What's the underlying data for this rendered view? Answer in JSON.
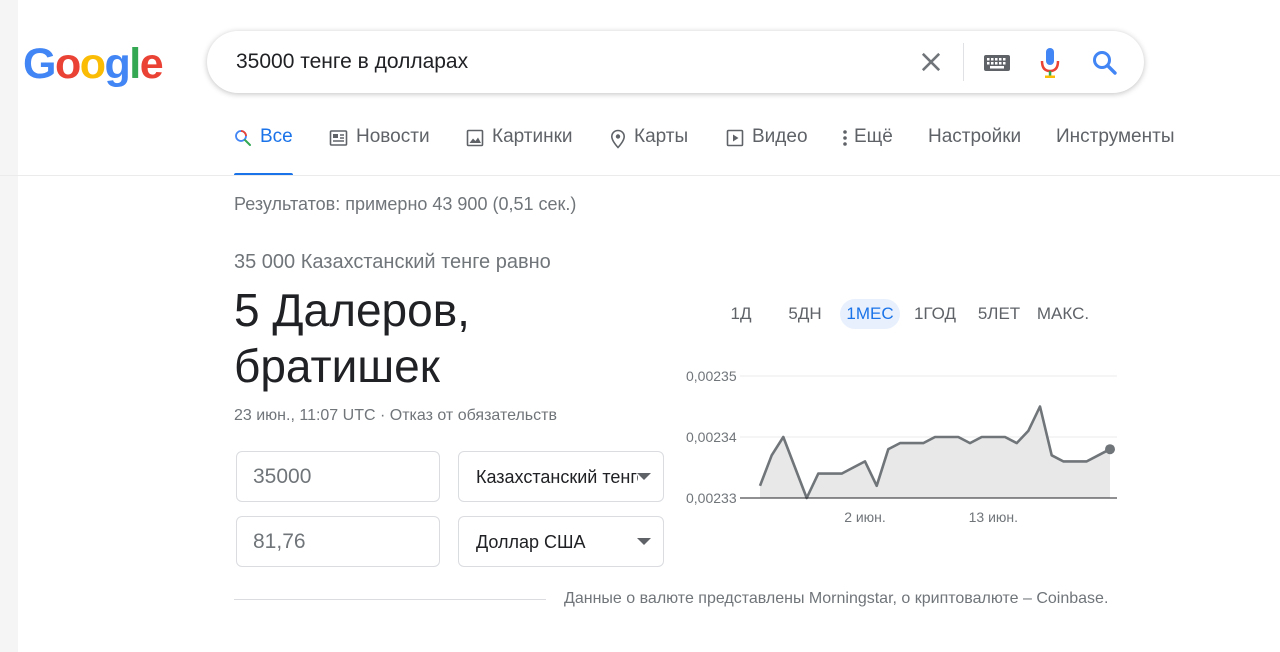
{
  "logo": {
    "letters": [
      "G",
      "o",
      "o",
      "g",
      "l",
      "e"
    ],
    "colors": [
      "#4285F4",
      "#EA4335",
      "#FBBC05",
      "#4285F4",
      "#34A853",
      "#EA4335"
    ]
  },
  "search": {
    "query": "35000 тенге в долларах"
  },
  "tabs": [
    {
      "label": "Все",
      "icon": "search-icon",
      "active": true
    },
    {
      "label": "Новости",
      "icon": "news-icon"
    },
    {
      "label": "Картинки",
      "icon": "image-icon"
    },
    {
      "label": "Карты",
      "icon": "map-pin-icon"
    },
    {
      "label": "Видео",
      "icon": "play-icon"
    },
    {
      "label": "Ещё",
      "icon": "more-vert-icon"
    },
    {
      "label": "Настройки"
    },
    {
      "label": "Инструменты"
    }
  ],
  "results_count": "Результатов: примерно 43 900 (0,51 сек.)",
  "converter": {
    "equals_line": "35 000 Казахстанский тенге равно",
    "result_line1": "5 Далеров,",
    "result_line2": "братишек",
    "timestamp": "23 июн., 11:07 UTC",
    "separator": " · ",
    "disclaimer": "Отказ от обязательств",
    "from_amount": "35000",
    "from_currency": "Казахстанский тенге",
    "to_amount": "81,76",
    "to_currency": "Доллар США"
  },
  "range_buttons": [
    {
      "label": "1Д"
    },
    {
      "label": "5ДН"
    },
    {
      "label": "1МЕС",
      "active": true
    },
    {
      "label": "1ГОД"
    },
    {
      "label": "5ЛЕТ"
    },
    {
      "label": "МАКС."
    }
  ],
  "chart_data": {
    "type": "area",
    "y_ticks": [
      0.00235,
      0.00234,
      0.00233
    ],
    "y_tick_labels": [
      "0,00235",
      "0,00234",
      "0,00233"
    ],
    "ylim": [
      0.00233,
      0.00235
    ],
    "x_tick_labels": [
      "2 июн.",
      "13 июн."
    ],
    "x_tick_index": [
      9,
      20
    ],
    "values": [
      0.002332,
      0.002337,
      0.00234,
      0.002335,
      0.00233,
      0.002334,
      0.002334,
      0.002334,
      0.002335,
      0.002336,
      0.002332,
      0.002338,
      0.002339,
      0.002339,
      0.002339,
      0.00234,
      0.00234,
      0.00234,
      0.002339,
      0.00234,
      0.00234,
      0.00234,
      0.002339,
      0.002341,
      0.002345,
      0.002337,
      0.002336,
      0.002336,
      0.002336,
      0.002337,
      0.002338
    ],
    "grid": true,
    "line_color": "#70757a",
    "fill_color": "#e8e8e8"
  },
  "source": "Данные о валюте представлены Morningstar, о криптовалюте – Coinbase."
}
